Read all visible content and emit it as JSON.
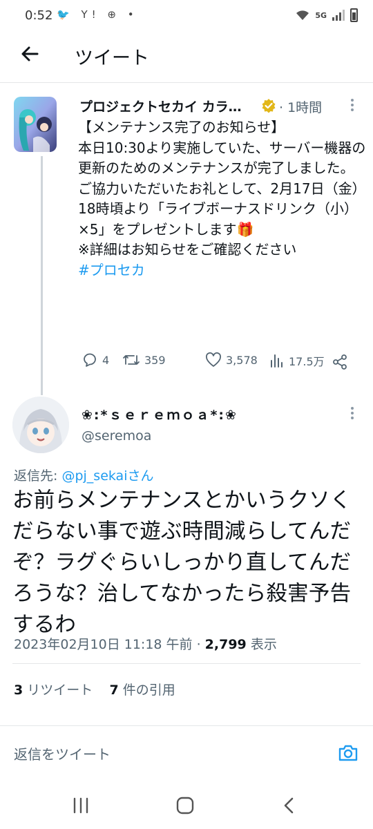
{
  "status_bar": {
    "time": "0:52",
    "left_icons": "🐦 Y! ⊕ •",
    "network": "5G"
  },
  "header": {
    "title": "ツイート"
  },
  "original_tweet": {
    "author_name": "プロジェクトセカイ カラ…",
    "time": "· 1時間",
    "lines": [
      "【メンテナンス完了のお知らせ】",
      "本日10:30より実施していた、サーバー機器の更新のためのメンテナンスが完了しました。",
      "",
      "ご協力いただいたお礼として、2月17日（金）18時頃より「ライブボーナスドリンク（小）×5」をプレゼントします🎁",
      "",
      "※詳細はお知らせをご確認ください"
    ],
    "hashtag": "#プロセカ",
    "replies": "4",
    "retweets": "359",
    "likes": "3,578",
    "views": "17.5万"
  },
  "reply_tweet": {
    "author_name": "❀:*ｓｅｒｅｍｏａ*:❀",
    "handle": "@seremoa",
    "reply_to_label": "返信先: ",
    "reply_to_mention": "@pj_sekaiさん",
    "text": "お前らメンテナンスとかいうクソくだらない事で遊ぶ時間減らしてんだぞ？ラグぐらいしっかり直してんだろうな？治してなかったら殺害予告するわ",
    "timestamp": "2023年02月10日 11:18 午前 · ",
    "view_count": "2,799",
    "view_label": " 表示",
    "retweet_count": "3",
    "retweet_label": " リツイート",
    "quote_count": "7",
    "quote_label": " 件の引用"
  },
  "compose": {
    "placeholder": "返信をツイート"
  },
  "colors": {
    "accent": "#1d9bf0",
    "text": "#0f1419",
    "secondary": "#536471",
    "verified": "#e2b719"
  }
}
